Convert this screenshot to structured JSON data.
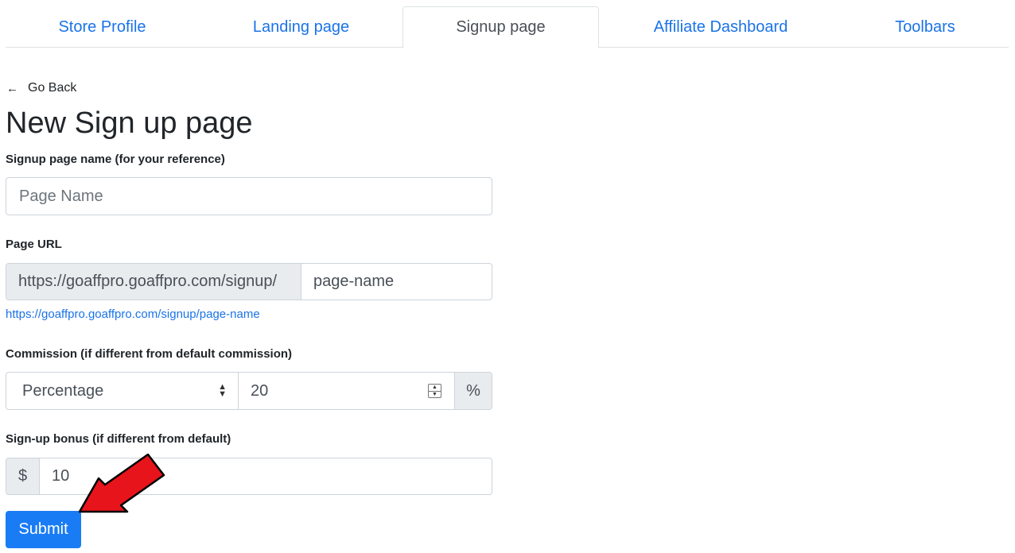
{
  "tabs": [
    {
      "label": "Store Profile",
      "active": false
    },
    {
      "label": "Landing page",
      "active": false
    },
    {
      "label": "Signup page",
      "active": true
    },
    {
      "label": "Affiliate Dashboard",
      "active": false
    },
    {
      "label": "Toolbars",
      "active": false
    }
  ],
  "nav": {
    "go_back": "Go Back"
  },
  "page_title": "New Sign up page",
  "form": {
    "name_label": "Signup page name (for your reference)",
    "name_placeholder": "Page Name",
    "url_label": "Page URL",
    "url_prefix": "https://goaffpro.goaffpro.com/signup/",
    "url_value": "page-name",
    "url_preview": "https://goaffpro.goaffpro.com/signup/page-name",
    "commission_label": "Commission (if different from default commission)",
    "commission_type": "Percentage",
    "commission_value": "20",
    "commission_unit": "%",
    "bonus_label": "Sign-up bonus (if different from default)",
    "bonus_currency": "$",
    "bonus_value": "10",
    "submit_label": "Submit"
  },
  "colors": {
    "accent": "#1a7cf5",
    "link": "#1a73e8",
    "annotation_arrow": "#e8141c"
  }
}
